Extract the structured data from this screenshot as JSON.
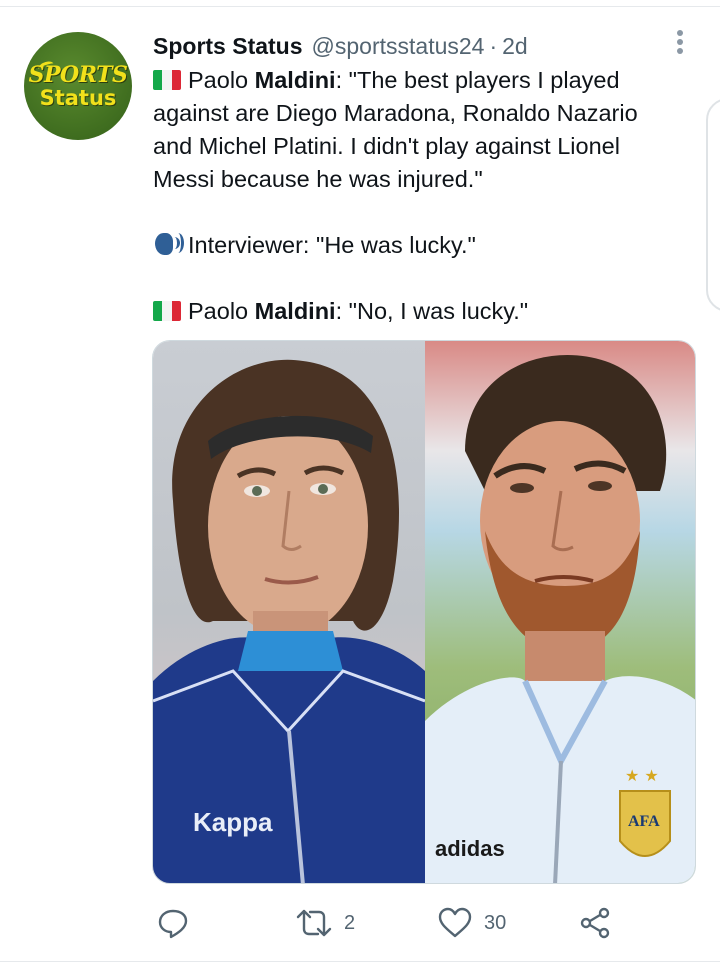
{
  "tweet": {
    "author_name": "Sports Status",
    "handle": "@sportsstatus24",
    "separator": "·",
    "time": "2d",
    "avatar_text_1": "SPORTS",
    "avatar_text_2": "Status",
    "lines": [
      {
        "pre": "Paolo ",
        "bold": "Maldini",
        "post": ": \"The best players I played"
      },
      {
        "text": "against are Diego Maradona, Ronaldo Nazario"
      },
      {
        "text": "and Michel Platini. I didn't play against Lionel"
      },
      {
        "text": "Messi because he was injured.\""
      },
      {
        "text": "Interviewer: \"He was lucky.\""
      },
      {
        "pre": "Paolo ",
        "bold": "Maldini",
        "post": ": \"No, I was lucky.\""
      }
    ],
    "icons": {
      "flag": "italy-flag-icon",
      "speaker": "speaking-head-icon",
      "more": "more-options-icon"
    }
  },
  "media": {
    "left_subject": "player-photo-maldini",
    "right_subject": "player-photo-messi",
    "left_brand_text": "Kappa",
    "right_brand_text": "adidas",
    "badge_text": "AFA"
  },
  "actions": {
    "reply_icon": "reply-icon",
    "retweet_icon": "retweet-icon",
    "retweet_count": "2",
    "like_icon": "heart-icon",
    "like_count": "30",
    "share_icon": "share-icon"
  },
  "colors": {
    "text": "#0f1419",
    "muted": "#536471",
    "avatar_bg": "#3f6d1f",
    "avatar_text": "#f2e11b"
  }
}
